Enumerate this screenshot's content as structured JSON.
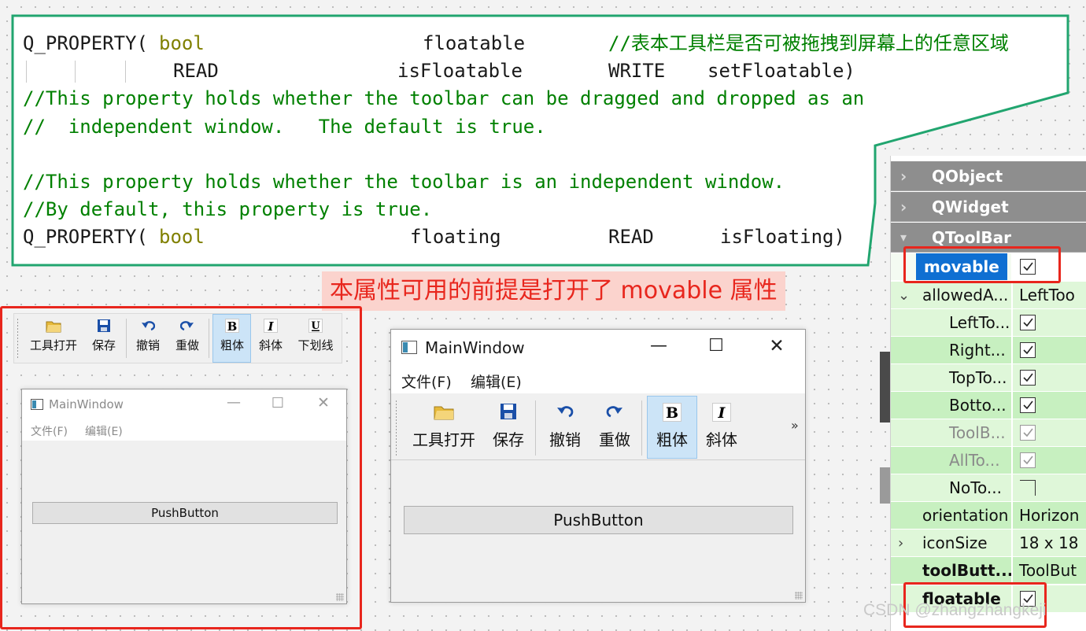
{
  "code": {
    "l1": {
      "kw": "Q_PROPERTY(",
      "type": "bool",
      "name": "floatable",
      "comment": "//表本工具栏是否可被拖拽到屏幕上的任意区域"
    },
    "l2": {
      "read": "READ",
      "getter": "isFloatable",
      "write": "WRITE",
      "setter": "setFloatable)"
    },
    "l3": "//This property holds whether the toolbar can be dragged and dropped as an",
    "l4": "//  independent window.   The default is true.",
    "l6": "//This property holds whether the toolbar is an independent window.",
    "l7": "//By default, this property is true.",
    "l8": {
      "kw": "Q_PROPERTY(",
      "type": "bool",
      "name": "floating",
      "read": "READ",
      "getter": "isFloating)"
    }
  },
  "annotation": "本属性可用的前提是打开了 movable 属性",
  "toolbar_strip": {
    "items": [
      "工具打开",
      "保存",
      "撤销",
      "重做",
      "粗体",
      "斜体",
      "下划线"
    ]
  },
  "window_small": {
    "title": "MainWindow",
    "menus": [
      "文件(F)",
      "编辑(E)"
    ],
    "button": "PushButton"
  },
  "window_large": {
    "title": "MainWindow",
    "menus": [
      "文件(F)",
      "编辑(E)"
    ],
    "toolbar": [
      "工具打开",
      "保存",
      "撤销",
      "重做",
      "粗体",
      "斜体"
    ],
    "overflow": "»",
    "button": "PushButton"
  },
  "properties": {
    "groups": [
      "QObject",
      "QWidget",
      "QToolBar"
    ],
    "rows": [
      {
        "name": "movable",
        "value": "checked"
      },
      {
        "name": "allowedA...",
        "value": "LeftToo"
      },
      {
        "name": "LeftTo...",
        "value": "checked"
      },
      {
        "name": "Right...",
        "value": "checked"
      },
      {
        "name": "TopTo...",
        "value": "checked"
      },
      {
        "name": "Botto...",
        "value": "checked"
      },
      {
        "name": "ToolB...",
        "value": "checked"
      },
      {
        "name": "AllTo...",
        "value": "checked"
      },
      {
        "name": "NoTo...",
        "value": "unchecked"
      },
      {
        "name": "orientation",
        "value": "Horizon"
      },
      {
        "name": "iconSize",
        "value": "18 x 18"
      },
      {
        "name": "toolButt...",
        "value": "ToolBut"
      },
      {
        "name": "floatable",
        "value": "checked"
      }
    ]
  },
  "watermark": "CSDN @zhangzhangkeji",
  "colors": {
    "keyword": "#808000",
    "comment": "#008000",
    "callout_border": "#21a56f",
    "highlight_red": "#e8261d",
    "group_header": "#8e8e8e",
    "row_green": "#c7f0c0",
    "selected_blue": "#0f6fd2"
  }
}
